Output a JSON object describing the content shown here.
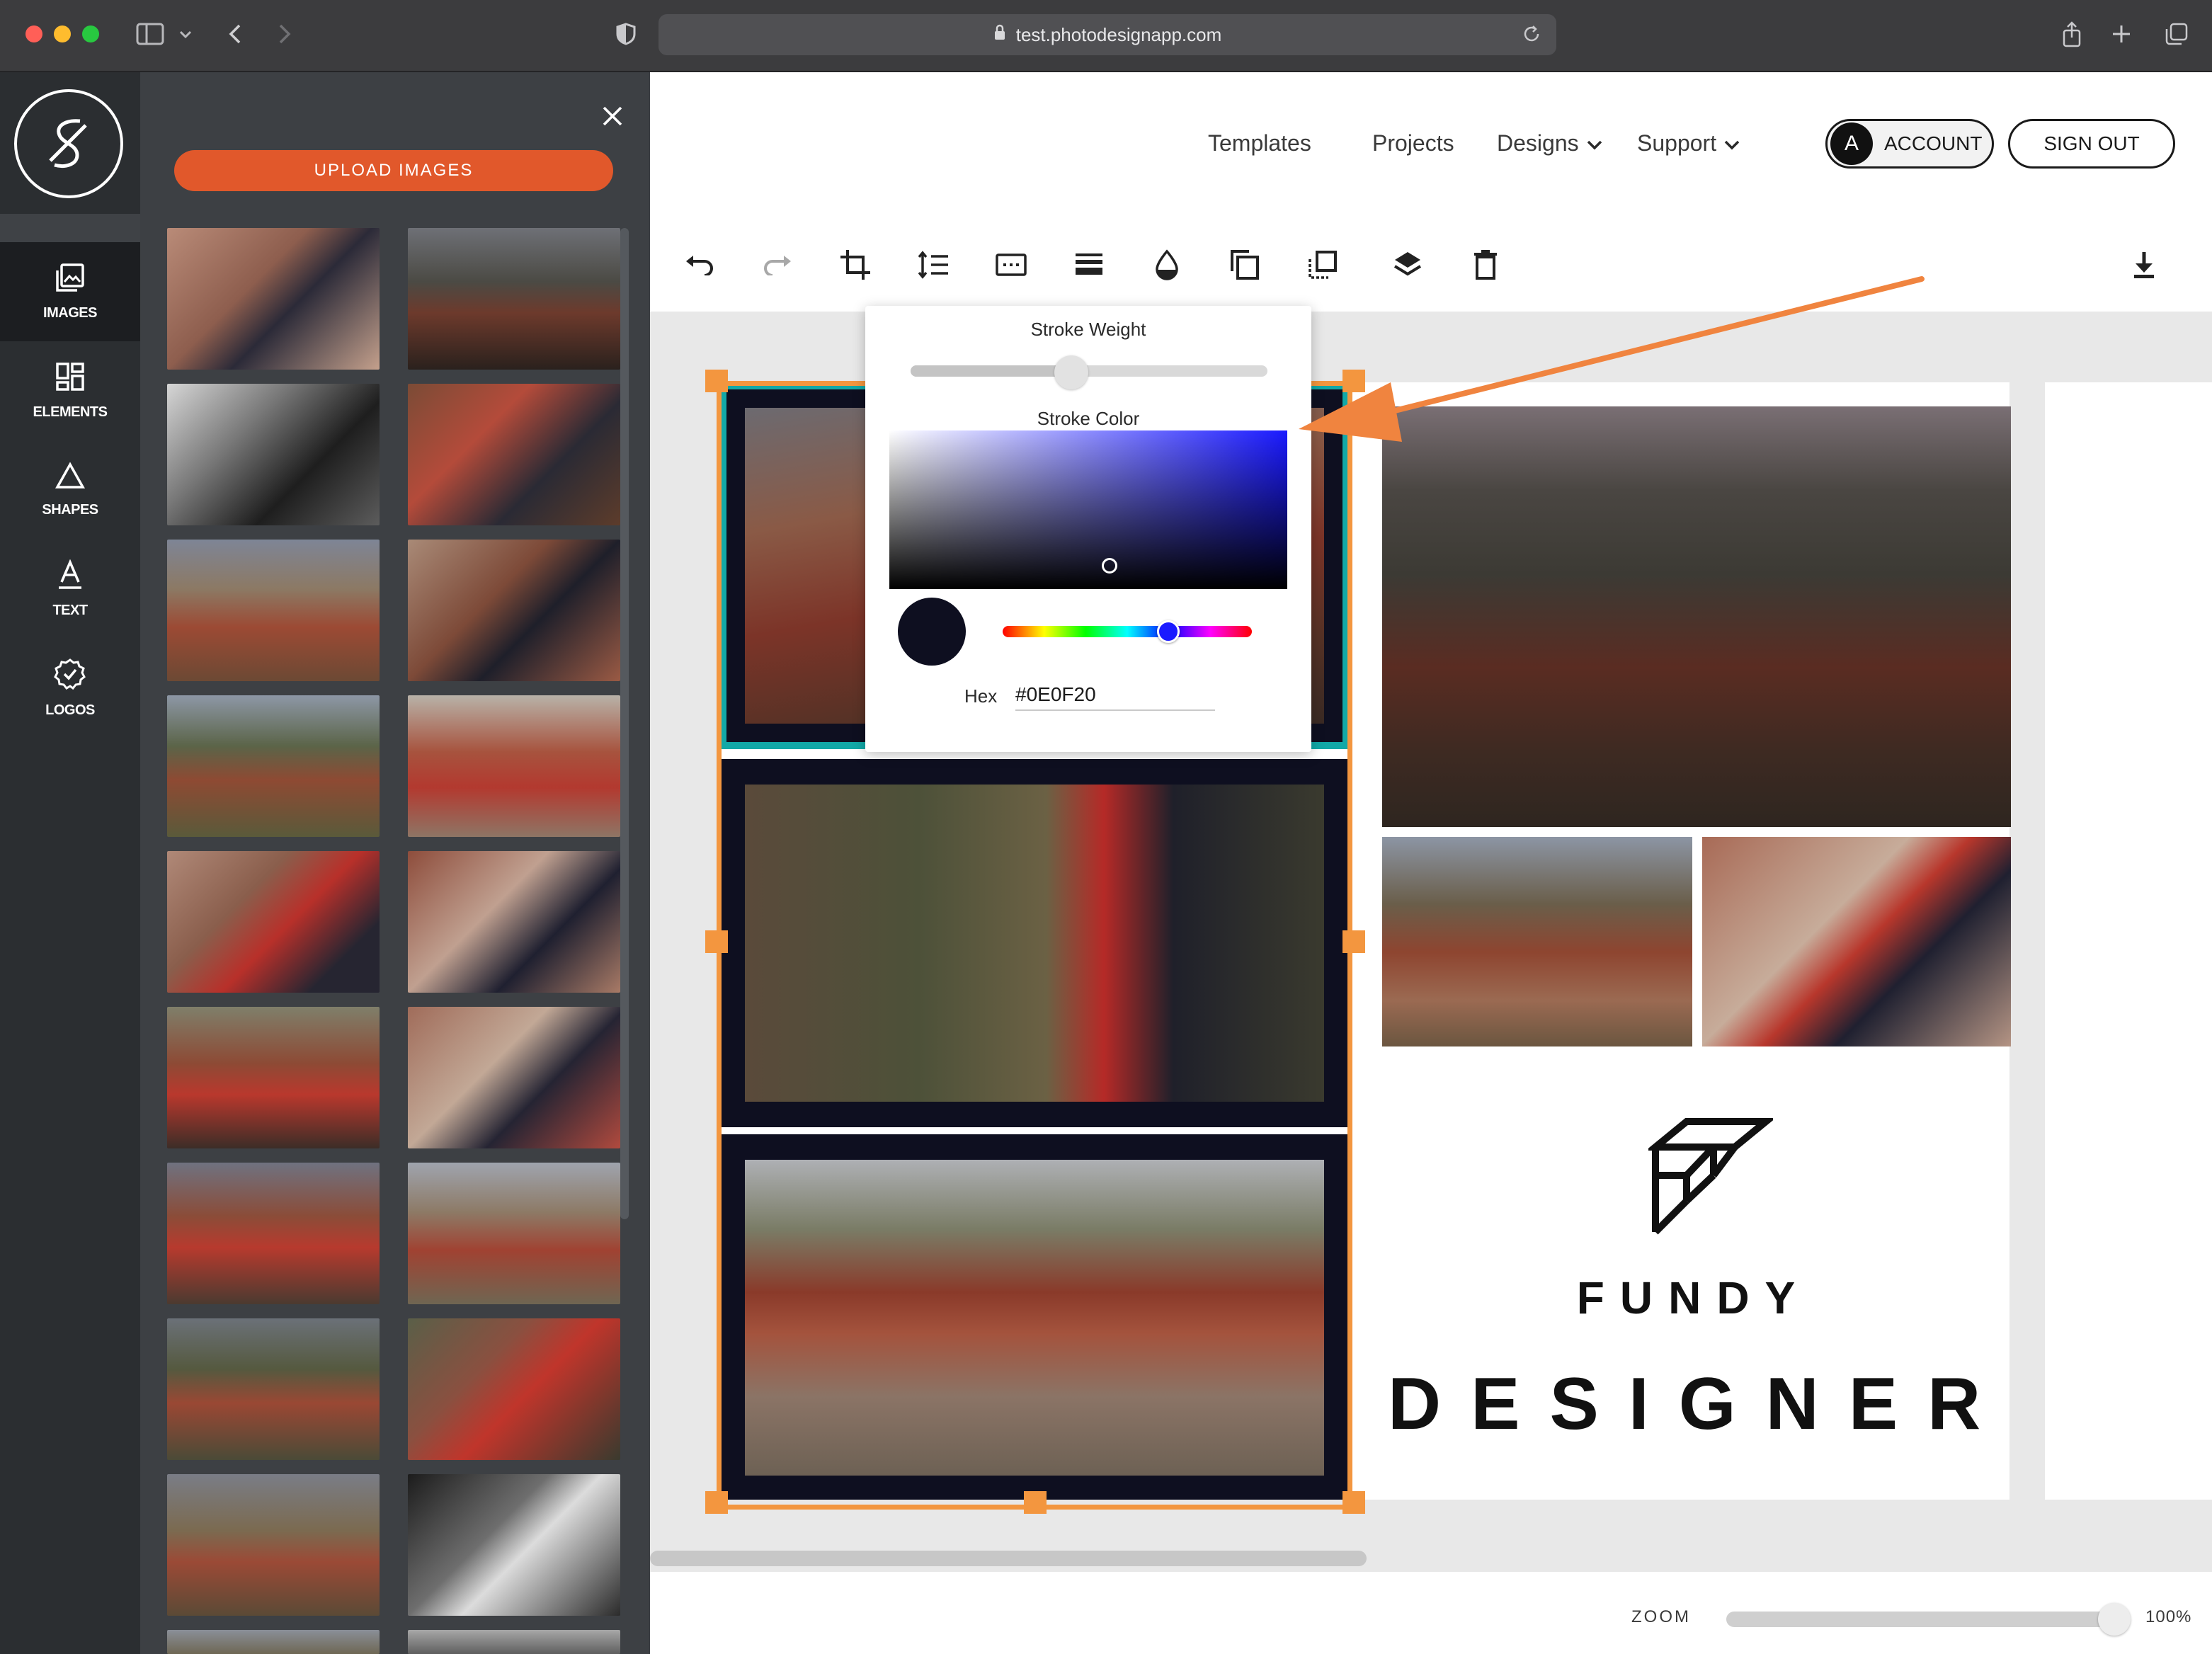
{
  "browser": {
    "url": "test.photodesignapp.com",
    "icons": [
      "sidebar-icon",
      "chevron-down-icon",
      "back-icon",
      "forward-icon",
      "shield-icon",
      "lock-icon",
      "reload-icon",
      "share-icon",
      "new-tab-icon",
      "tab-overview-icon"
    ]
  },
  "rail": {
    "items": [
      {
        "label": "IMAGES",
        "icon": "images-icon",
        "active": true
      },
      {
        "label": "ELEMENTS",
        "icon": "elements-icon"
      },
      {
        "label": "SHAPES",
        "icon": "shapes-icon"
      },
      {
        "label": "TEXT",
        "icon": "text-icon"
      },
      {
        "label": "LOGOS",
        "icon": "logos-icon"
      }
    ]
  },
  "panel": {
    "upload_label": "UPLOAD IMAGES",
    "accent": "#e1582b",
    "thumbnail_count": 20
  },
  "nav": {
    "templates": "Templates",
    "projects": "Projects",
    "designs": "Designs",
    "support": "Support",
    "account_initial": "A",
    "account": "ACCOUNT",
    "sign_out": "SIGN OUT"
  },
  "toolbar": {
    "tools": [
      "undo-icon",
      "redo-icon",
      "crop-icon",
      "line-spacing-icon",
      "caption-icon",
      "stroke-weight-icon",
      "opacity-icon",
      "duplicate-icon",
      "arrange-icon",
      "layers-icon",
      "delete-icon",
      "download-icon"
    ]
  },
  "stroke_popover": {
    "weight_label": "Stroke Weight",
    "weight_fraction": 0.45,
    "color_label": "Stroke Color",
    "hue_color": "#1a1aff",
    "hex_label": "Hex",
    "hex_value": "#0E0F20",
    "swatch_color": "#0e0f20"
  },
  "canvas": {
    "frame_color": "#0e0f20",
    "selection_color": "#f3963f",
    "highlight_color": "#12a8a7",
    "brand_line1": "FUNDY",
    "brand_line2": "DESIGNER"
  },
  "zoom": {
    "label": "ZOOM",
    "value": "100%",
    "fraction": 1.0
  }
}
